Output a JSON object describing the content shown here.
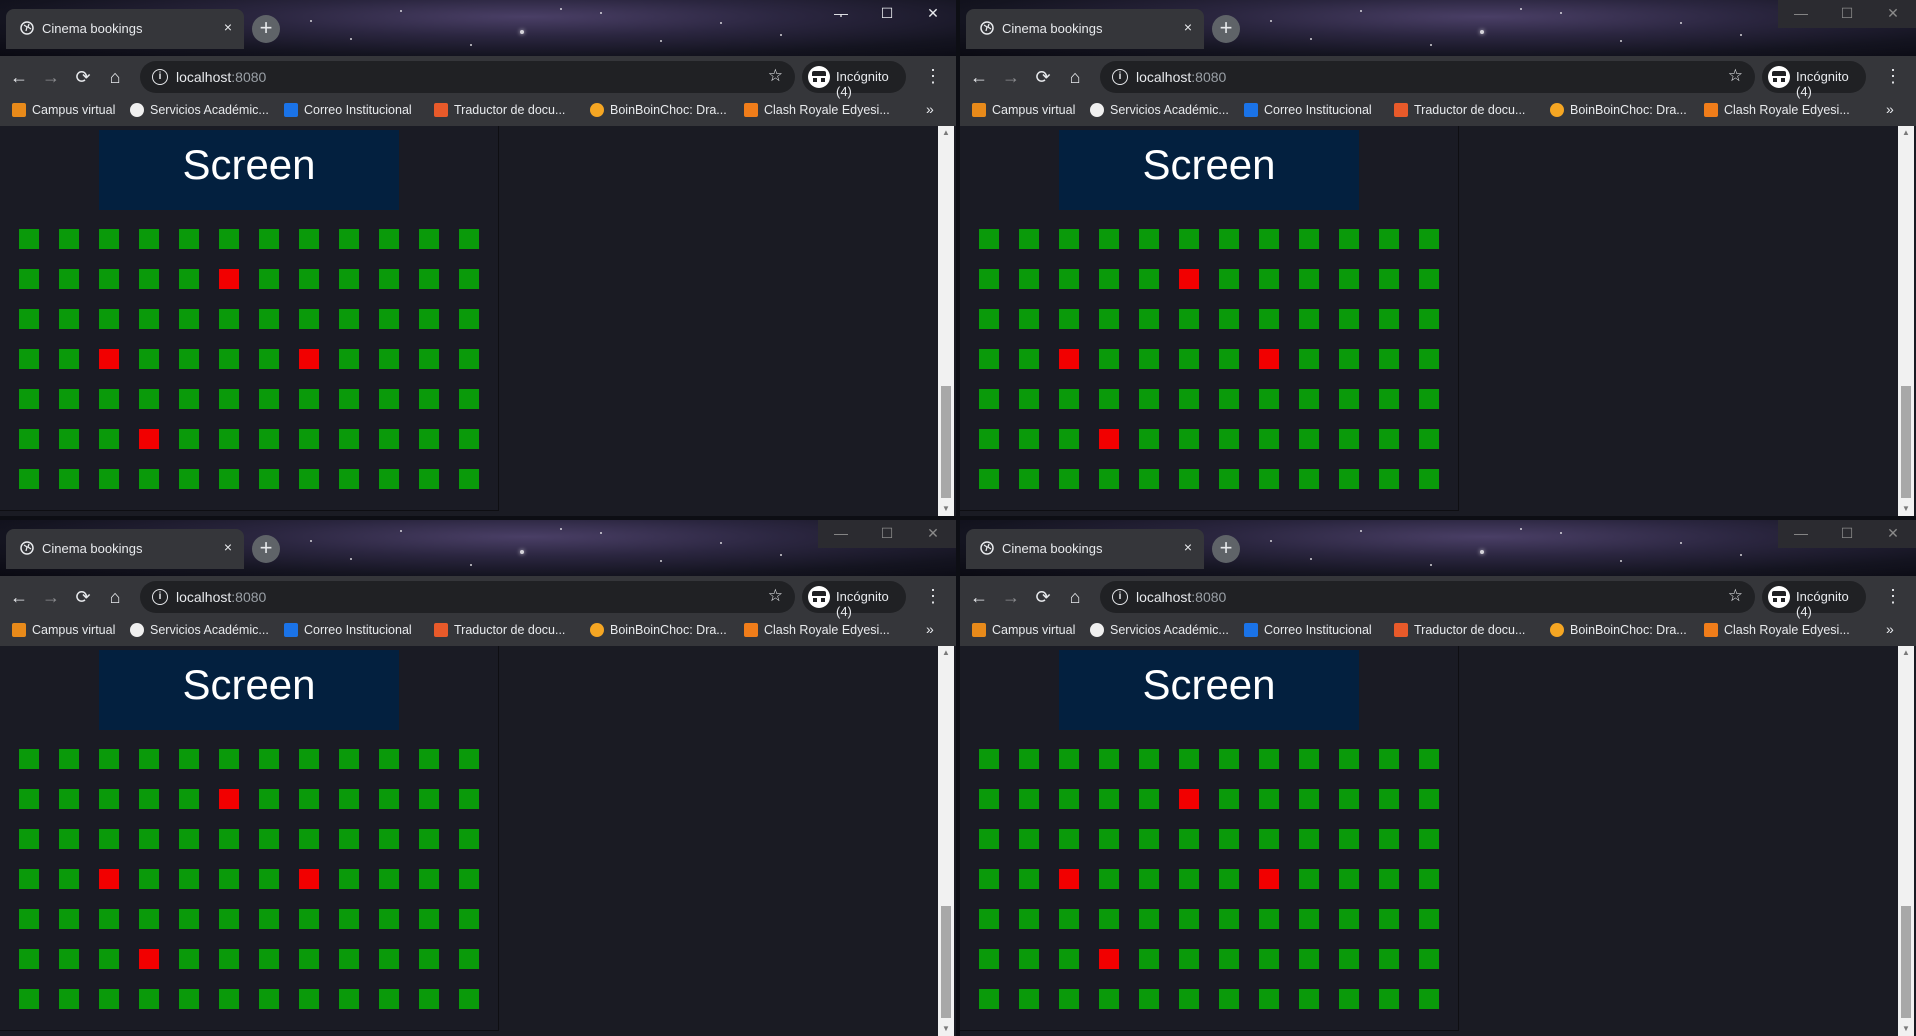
{
  "windows": [
    {
      "tab": {
        "title": "Cinema bookings",
        "close": "×"
      },
      "new_tab": "+",
      "controls": {
        "minimize": "—",
        "maximize": "☐",
        "close": "✕"
      },
      "omnibox": {
        "host": "localhost",
        "port": ":8080"
      },
      "incognito": "Incógnito (4)",
      "bookmarks": [
        "Campus virtual",
        "Servicios Académic...",
        "Correo Institucional",
        "Traductor de docu...",
        "BoinBoinChoc: Dra...",
        "Clash Royale Edyesi..."
      ],
      "bookmarks_more": "»",
      "page": {
        "screen_label": "Screen"
      }
    },
    {
      "tab": {
        "title": "Cinema bookings",
        "close": "×"
      },
      "new_tab": "+",
      "controls": {
        "minimize": "—",
        "maximize": "☐",
        "close": "✕"
      },
      "omnibox": {
        "host": "localhost",
        "port": ":8080"
      },
      "incognito": "Incógnito (4)",
      "bookmarks": [
        "Campus virtual",
        "Servicios Académic...",
        "Correo Institucional",
        "Traductor de docu...",
        "BoinBoinChoc: Dra...",
        "Clash Royale Edyesi..."
      ],
      "bookmarks_more": "»",
      "page": {
        "screen_label": "Screen"
      }
    },
    {
      "tab": {
        "title": "Cinema bookings",
        "close": "×"
      },
      "new_tab": "+",
      "controls": {
        "minimize": "—",
        "maximize": "☐",
        "close": "✕"
      },
      "omnibox": {
        "host": "localhost",
        "port": ":8080"
      },
      "incognito": "Incógnito (4)",
      "bookmarks": [
        "Campus virtual",
        "Servicios Académic...",
        "Correo Institucional",
        "Traductor de docu...",
        "BoinBoinChoc: Dra...",
        "Clash Royale Edyesi..."
      ],
      "bookmarks_more": "»",
      "page": {
        "screen_label": "Screen"
      }
    },
    {
      "tab": {
        "title": "Cinema bookings",
        "close": "×"
      },
      "new_tab": "+",
      "controls": {
        "minimize": "—",
        "maximize": "☐",
        "close": "✕"
      },
      "omnibox": {
        "host": "localhost",
        "port": ":8080"
      },
      "incognito": "Incógnito (4)",
      "bookmarks": [
        "Campus virtual",
        "Servicios Académic...",
        "Correo Institucional",
        "Traductor de docu...",
        "BoinBoinChoc: Dra...",
        "Clash Royale Edyesi..."
      ],
      "bookmarks_more": "»",
      "page": {
        "screen_label": "Screen"
      }
    }
  ],
  "seating": {
    "rows": 7,
    "cols": 12,
    "occupied": [
      [
        1,
        5
      ],
      [
        3,
        2
      ],
      [
        3,
        7
      ],
      [
        5,
        3
      ]
    ],
    "colors": {
      "available": "#0a9a0a",
      "occupied": "#f20000"
    }
  },
  "icons": {
    "favicon": "globe-icon",
    "back": "arrow-left-icon",
    "forward": "arrow-right-icon",
    "reload": "reload-icon",
    "home": "home-icon",
    "info": "info-icon",
    "bookmark_star": "star-icon",
    "incognito": "incognito-icon",
    "menu": "kebab-menu-icon"
  },
  "nav_glyphs": {
    "back": "←",
    "forward": "→",
    "reload": "⟳",
    "home": "⌂",
    "info": "i",
    "star": "☆",
    "menu": "⋮",
    "scroll_up": "▲",
    "scroll_down": "▼"
  }
}
